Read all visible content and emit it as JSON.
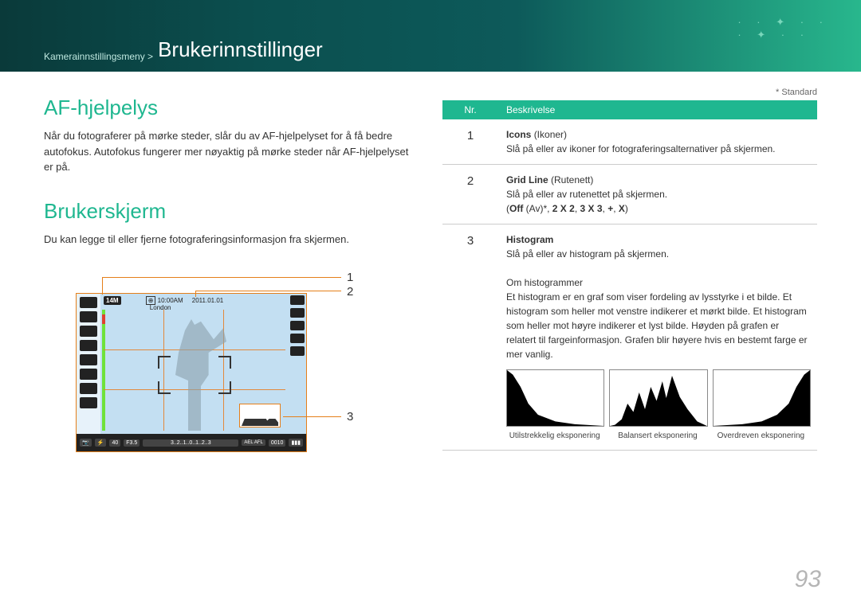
{
  "breadcrumb": {
    "parent": "Kamerainnstillingsmeny >",
    "current": "Brukerinnstillinger"
  },
  "left": {
    "sec1_title": "AF-hjelpelys",
    "sec1_body": "Når du fotograferer på mørke steder, slår du av AF-hjelpelyset for å få bedre autofokus. Autofokus fungerer mer nøyaktig på mørke steder når AF-hjelpelyset er på.",
    "sec2_title": "Brukerskjerm",
    "sec2_body": "Du kan legge til eller fjerne fotograferingsinformasjon fra skjermen."
  },
  "lcd": {
    "size": "14M",
    "time": "10:00AM",
    "date": "2011.01.01",
    "place": "London",
    "shutter": "40",
    "aperture": "F3.5",
    "ael": "AEL\nAFL",
    "shots": "0010",
    "meter_scale": "3..2..1..0..1..2..3"
  },
  "callouts": {
    "n1": "1",
    "n2": "2",
    "n3": "3"
  },
  "right": {
    "standard_note": "* Standard",
    "th_nr": "Nr.",
    "th_desc": "Beskrivelse",
    "rows": [
      {
        "nr": "1",
        "title": "Icons",
        "paren": "(Ikoner)",
        "body": "Slå på eller av ikoner for fotograferingsalternativer på skjermen."
      },
      {
        "nr": "2",
        "title": "Grid Line",
        "paren": "(Rutenett)",
        "body": "Slå på eller av rutenettet på skjermen.",
        "opts": "(Off (Av)*, 2 X 2, 3 X 3, +, X)"
      },
      {
        "nr": "3",
        "title": "Histogram",
        "paren": "",
        "body": "Slå på eller av histogram på skjermen.",
        "sub_heading": "Om histogrammer",
        "sub_body": "Et histogram er en graf som viser fordeling av lysstyrke i et bilde. Et histogram som heller mot venstre indikerer et mørkt bilde. Et histogram som heller mot høyre indikerer et lyst bilde. Høyden på grafen er relatert til fargeinformasjon. Grafen blir høyere hvis en bestemt farge er mer vanlig."
      }
    ],
    "histo_caps": [
      "Utilstrekkelig eksponering",
      "Balansert eksponering",
      "Overdreven eksponering"
    ]
  },
  "page_number": "93"
}
